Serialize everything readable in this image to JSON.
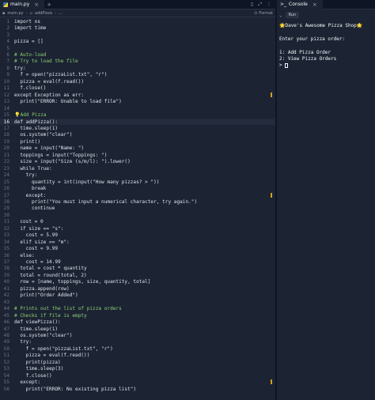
{
  "editor": {
    "tab_label": "main.py",
    "breadcrumb": [
      "main.py",
      "addPizza",
      "..."
    ],
    "format_label": "Format",
    "current_line": 16,
    "lines": [
      {
        "n": 1,
        "t": "import os"
      },
      {
        "n": 2,
        "t": "import time"
      },
      {
        "n": 3,
        "t": ""
      },
      {
        "n": 4,
        "t": "pizza = []"
      },
      {
        "n": 5,
        "t": ""
      },
      {
        "n": 6,
        "t": "# Auto-load",
        "c": true
      },
      {
        "n": 7,
        "t": "# Try to load the file",
        "c": true
      },
      {
        "n": 8,
        "t": "try:"
      },
      {
        "n": 9,
        "t": "  f = open(\"pizzaList.txt\", \"r\")"
      },
      {
        "n": 10,
        "t": "  pizza = eval(f.read())"
      },
      {
        "n": 11,
        "t": "  f.close()"
      },
      {
        "n": 12,
        "t": "except Exception as err:",
        "m": true
      },
      {
        "n": 13,
        "t": "  print(\"ERROR: Unable to load file\")"
      },
      {
        "n": 14,
        "t": ""
      },
      {
        "n": 15,
        "t": "💡Add Pizza",
        "c": true
      },
      {
        "n": 16,
        "t": "def addPizza():"
      },
      {
        "n": 17,
        "t": "  time.sleep(1)"
      },
      {
        "n": 18,
        "t": "  os.system(\"clear\")"
      },
      {
        "n": 19,
        "t": "  print()"
      },
      {
        "n": 20,
        "t": "  name = input(\"Name: \")"
      },
      {
        "n": 21,
        "t": "  toppings = input(\"Toppings: \")"
      },
      {
        "n": 22,
        "t": "  size = input(\"Size (s/m/l): \").lower()"
      },
      {
        "n": 23,
        "t": "  while True:"
      },
      {
        "n": 24,
        "t": "    try:"
      },
      {
        "n": 25,
        "t": "      quantity = int(input(\"How many pizzas? > \"))"
      },
      {
        "n": 26,
        "t": "      break"
      },
      {
        "n": 27,
        "t": "    except:",
        "m": true
      },
      {
        "n": 28,
        "t": "      print(\"You must input a numerical character, try again.\")"
      },
      {
        "n": 29,
        "t": "      continue"
      },
      {
        "n": 30,
        "t": ""
      },
      {
        "n": 31,
        "t": "  cost = 0"
      },
      {
        "n": 32,
        "t": "  if size == \"s\":"
      },
      {
        "n": 33,
        "t": "    cost = 5.99"
      },
      {
        "n": 34,
        "t": "  elif size == \"m\":"
      },
      {
        "n": 35,
        "t": "    cost = 9.99"
      },
      {
        "n": 36,
        "t": "  else:"
      },
      {
        "n": 37,
        "t": "    cost = 14.99"
      },
      {
        "n": 38,
        "t": "  total = cost * quantity"
      },
      {
        "n": 39,
        "t": "  total = round(total, 2)"
      },
      {
        "n": 40,
        "t": "  row = [name, toppings, size, quantity, total]"
      },
      {
        "n": 41,
        "t": "  pizza.append(row)"
      },
      {
        "n": 42,
        "t": "  print(\"Order Added\")"
      },
      {
        "n": 43,
        "t": ""
      },
      {
        "n": 44,
        "t": "# Prints out the list of pizza orders",
        "c": true
      },
      {
        "n": 45,
        "t": "# Checks if file is empty",
        "c": true
      },
      {
        "n": 46,
        "t": "def viewPizza():"
      },
      {
        "n": 47,
        "t": "  time.sleep(1)"
      },
      {
        "n": 48,
        "t": "  os.system(\"clear\")"
      },
      {
        "n": 49,
        "t": "  try:"
      },
      {
        "n": 50,
        "t": "    f = open(\"pizzaList.txt\", \"r\")"
      },
      {
        "n": 51,
        "t": "    pizza = eval(f.read())"
      },
      {
        "n": 52,
        "t": "    print(pizza)"
      },
      {
        "n": 53,
        "t": "    time.sleep(3)"
      },
      {
        "n": 54,
        "t": "    f.close()"
      },
      {
        "n": 55,
        "t": "  except:",
        "m": true
      },
      {
        "n": 56,
        "t": "    print(\"ERROR: No existing pizza list\")"
      }
    ]
  },
  "console": {
    "tab_label": "Console",
    "run_label": "Run",
    "output": "🌟Dave's Awesome Pizza Shop🌟\n\nEnter your pizza order:\n\n1: Add Pizza Order\n2: View Pizza Orders\n> "
  }
}
